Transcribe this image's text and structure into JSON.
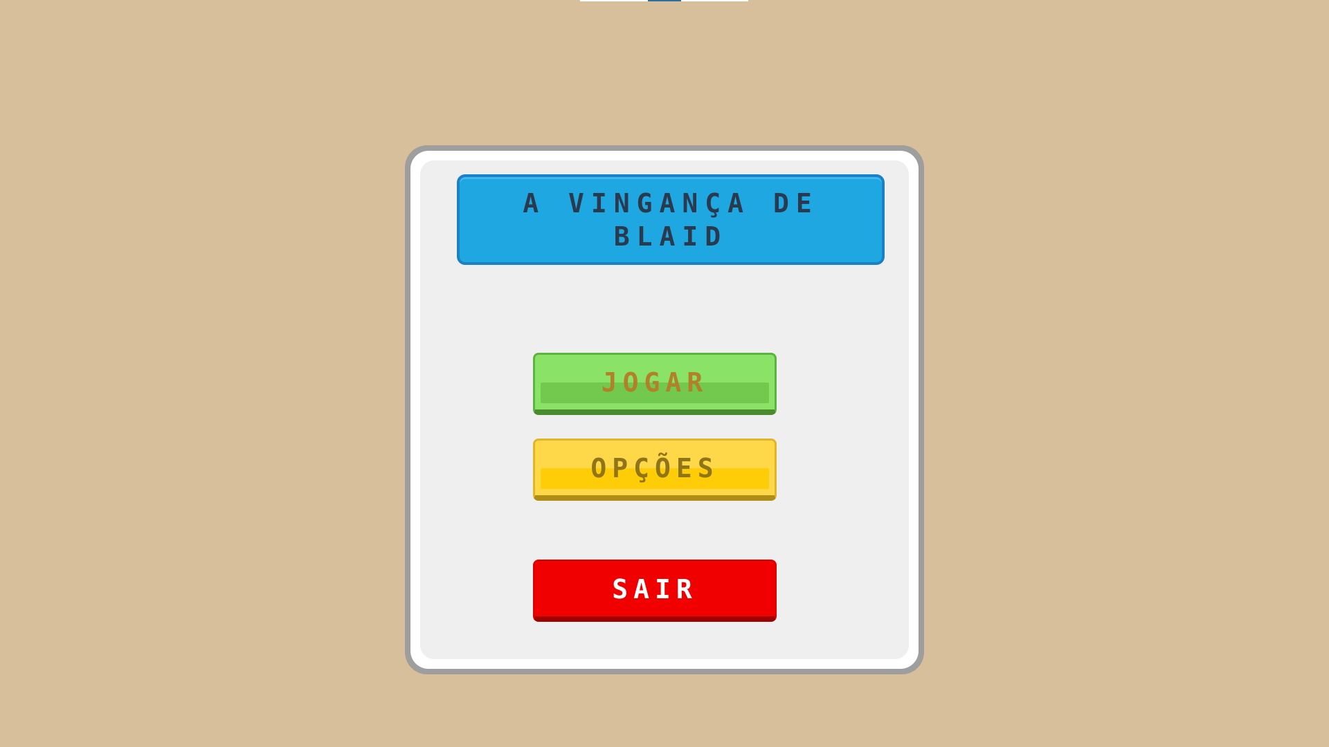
{
  "title": "A VINGANÇA DE BLAID",
  "menu": {
    "play_label": "JOGAR",
    "options_label": "OPÇÕES",
    "exit_label": "SAIR"
  },
  "colors": {
    "background": "#d8bf9c",
    "title_box": "#1fa7e1",
    "play_button": "#8ae266",
    "options_button": "#ffd84a",
    "exit_button": "#f00000"
  }
}
